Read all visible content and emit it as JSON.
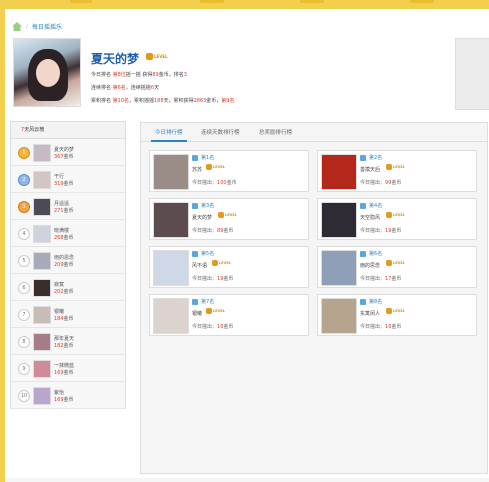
{
  "breadcrumb": {
    "current": "每日摇摇乐"
  },
  "profile": {
    "name": "夏天的梦",
    "vip_label": "LEVEL",
    "today_line": [
      "今日排名 ",
      "第8位",
      "摇一摇 获得",
      "89",
      "金币，排名",
      "3"
    ],
    "streak_line": [
      "连续排名 ",
      "第6名",
      "，连续摇摇",
      "6",
      "天"
    ],
    "total_line": [
      "累积排名 ",
      "第10名",
      "，累积摇摇",
      "188",
      "天，累积获得",
      "2863",
      "金币，",
      "第9名"
    ]
  },
  "week_ranking": {
    "title_prefix": "7",
    "title_suffix": "天风云榜",
    "unit": "金币",
    "items": [
      {
        "rank": "1",
        "name": "夏天的梦",
        "gold": "367",
        "color": "#c7b9c6"
      },
      {
        "rank": "2",
        "name": "干行",
        "gold": "319",
        "color": "#d3c5c1"
      },
      {
        "rank": "3",
        "name": "月遥遥",
        "gold": "271",
        "color": "#4d4a58"
      },
      {
        "rank": "4",
        "name": "晓满楼",
        "gold": "268",
        "color": "#cfd3dc"
      },
      {
        "rank": "5",
        "name": "雨的恩念",
        "gold": "209",
        "color": "#a7abb8"
      },
      {
        "rank": "6",
        "name": "寂寞",
        "gold": "202",
        "color": "#3a2d2b"
      },
      {
        "rank": "7",
        "name": "银曦",
        "gold": "184",
        "color": "#c9bcb7"
      },
      {
        "rank": "8",
        "name": "那年夏天",
        "gold": "182",
        "color": "#a67d86"
      },
      {
        "rank": "9",
        "name": "一抹微蓝",
        "gold": "169",
        "color": "#d08a98"
      },
      {
        "rank": "10",
        "name": "紫怡",
        "gold": "169",
        "color": "#b8a6cc"
      }
    ]
  },
  "tabs": [
    "今日排行榜",
    "连续天数排行榜",
    "总奖励排行榜"
  ],
  "today": {
    "rank_prefix": "第",
    "rank_suffix": "名",
    "today_label": "今日摇出：",
    "unit": "金币",
    "cards": [
      {
        "rank": "1",
        "name": "苏苏",
        "gold": "100",
        "color": "#9a8c86"
      },
      {
        "rank": "2",
        "name": "善摸天后",
        "gold": "99",
        "color": "#b4281c"
      },
      {
        "rank": "3",
        "name": "夏天的梦",
        "gold": "89",
        "color": "#5d4c4d"
      },
      {
        "rank": "4",
        "name": "天空隐风",
        "gold": "19",
        "color": "#2f2a33"
      },
      {
        "rank": "5",
        "name": "风不语",
        "gold": "19",
        "color": "#cfd8e6"
      },
      {
        "rank": "6",
        "name": "雨的思念",
        "gold": "17",
        "color": "#8e9fb8"
      },
      {
        "rank": "7",
        "name": "银曦",
        "gold": "16",
        "color": "#dcd3cf"
      },
      {
        "rank": "8",
        "name": "东篱闲人",
        "gold": "16",
        "color": "#b7a48e"
      }
    ]
  }
}
